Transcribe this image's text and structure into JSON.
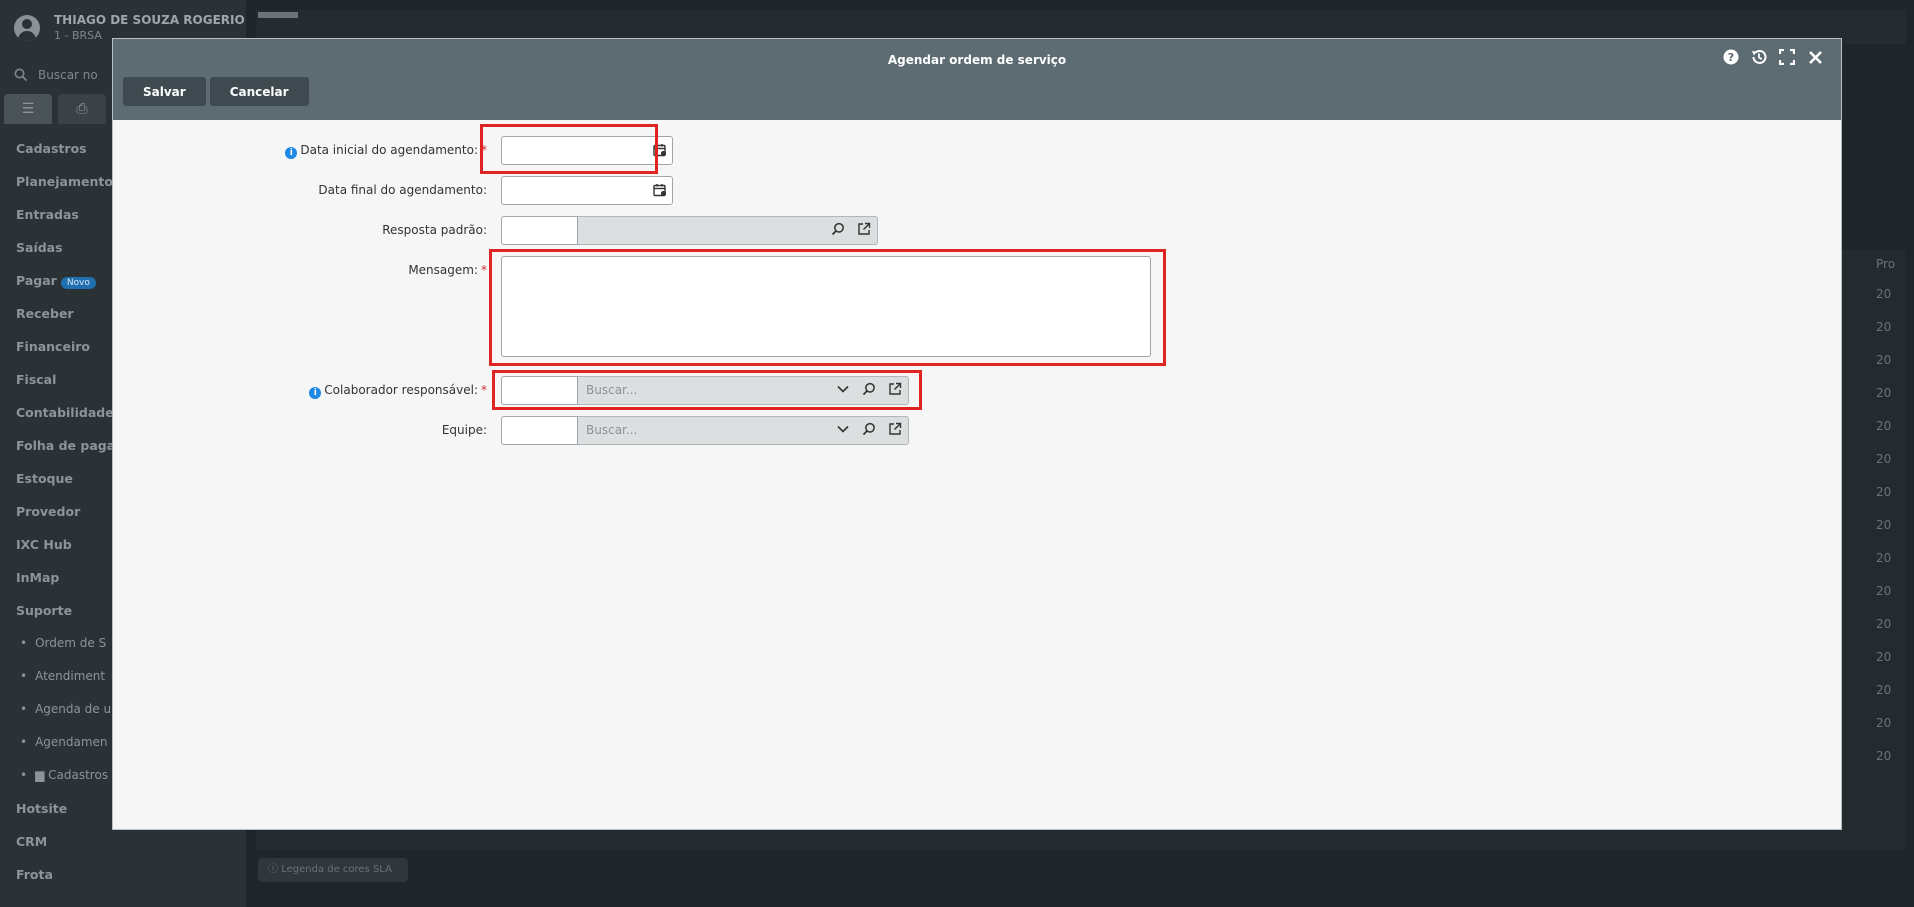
{
  "background": {
    "user_name": "THIAGO DE SOUZA ROGERIO",
    "user_sub": "1 - BRSA",
    "search_placeholder": "Buscar no",
    "menu": [
      "Cadastros",
      "Planejamento",
      "Entradas",
      "Saídas",
      "Pagar",
      "Receber",
      "Financeiro",
      "Fiscal",
      "Contabilidade",
      "Folha de pagar",
      "Estoque",
      "Provedor",
      "IXC Hub",
      "InMap",
      "Suporte"
    ],
    "menu_badge": "Novo",
    "submenu": [
      "Ordem de S",
      "Atendiment",
      "Agenda de u",
      "Agendamen",
      "Cadastros"
    ],
    "menu_bottom": [
      "Hotsite",
      "CRM",
      "Frota"
    ],
    "table_header": "Pro",
    "table_col": [
      "20",
      "20",
      "20",
      "20",
      "20",
      "20",
      "20",
      "20",
      "20",
      "20",
      "20",
      "20",
      "20",
      "20",
      "20"
    ],
    "footer": "Legenda de cores SLA"
  },
  "modal": {
    "title": "Agendar ordem de serviço",
    "save_label": "Salvar",
    "cancel_label": "Cancelar",
    "fields": {
      "data_inicial": {
        "label": "Data inicial do agendamento:",
        "required": "*"
      },
      "data_final": {
        "label": "Data final do agendamento:"
      },
      "resposta_padrao": {
        "label": "Resposta padrão:"
      },
      "mensagem": {
        "label": "Mensagem:",
        "required": "*"
      },
      "colaborador": {
        "label": "Colaborador responsável:",
        "required": "*",
        "placeholder": "Buscar..."
      },
      "equipe": {
        "label": "Equipe:",
        "placeholder": "Buscar..."
      }
    }
  },
  "colors": {
    "accent_red": "#e02424",
    "header": "#5d6b72",
    "info_blue": "#1e88e5"
  }
}
